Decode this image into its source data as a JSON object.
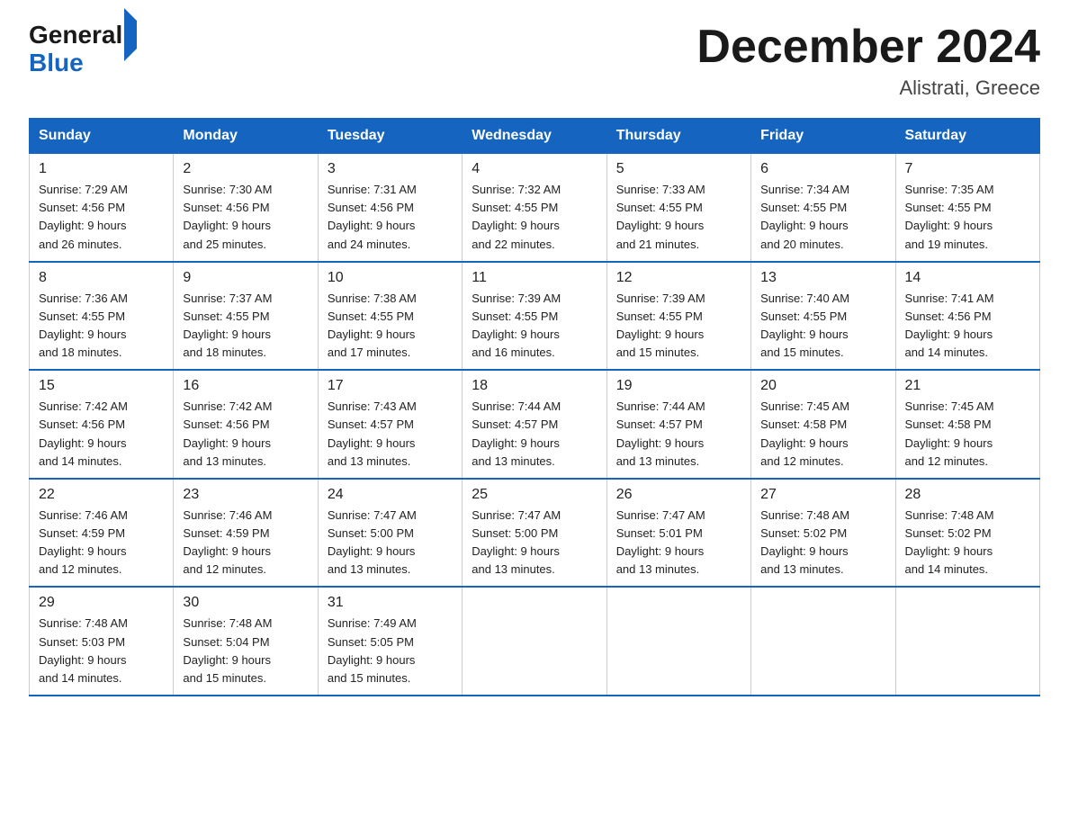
{
  "logo": {
    "general": "General",
    "blue": "Blue"
  },
  "title": "December 2024",
  "location": "Alistrati, Greece",
  "weekdays": [
    "Sunday",
    "Monday",
    "Tuesday",
    "Wednesday",
    "Thursday",
    "Friday",
    "Saturday"
  ],
  "weeks": [
    [
      {
        "day": "1",
        "sunrise": "7:29 AM",
        "sunset": "4:56 PM",
        "daylight": "9 hours and 26 minutes."
      },
      {
        "day": "2",
        "sunrise": "7:30 AM",
        "sunset": "4:56 PM",
        "daylight": "9 hours and 25 minutes."
      },
      {
        "day": "3",
        "sunrise": "7:31 AM",
        "sunset": "4:56 PM",
        "daylight": "9 hours and 24 minutes."
      },
      {
        "day": "4",
        "sunrise": "7:32 AM",
        "sunset": "4:55 PM",
        "daylight": "9 hours and 22 minutes."
      },
      {
        "day": "5",
        "sunrise": "7:33 AM",
        "sunset": "4:55 PM",
        "daylight": "9 hours and 21 minutes."
      },
      {
        "day": "6",
        "sunrise": "7:34 AM",
        "sunset": "4:55 PM",
        "daylight": "9 hours and 20 minutes."
      },
      {
        "day": "7",
        "sunrise": "7:35 AM",
        "sunset": "4:55 PM",
        "daylight": "9 hours and 19 minutes."
      }
    ],
    [
      {
        "day": "8",
        "sunrise": "7:36 AM",
        "sunset": "4:55 PM",
        "daylight": "9 hours and 18 minutes."
      },
      {
        "day": "9",
        "sunrise": "7:37 AM",
        "sunset": "4:55 PM",
        "daylight": "9 hours and 18 minutes."
      },
      {
        "day": "10",
        "sunrise": "7:38 AM",
        "sunset": "4:55 PM",
        "daylight": "9 hours and 17 minutes."
      },
      {
        "day": "11",
        "sunrise": "7:39 AM",
        "sunset": "4:55 PM",
        "daylight": "9 hours and 16 minutes."
      },
      {
        "day": "12",
        "sunrise": "7:39 AM",
        "sunset": "4:55 PM",
        "daylight": "9 hours and 15 minutes."
      },
      {
        "day": "13",
        "sunrise": "7:40 AM",
        "sunset": "4:55 PM",
        "daylight": "9 hours and 15 minutes."
      },
      {
        "day": "14",
        "sunrise": "7:41 AM",
        "sunset": "4:56 PM",
        "daylight": "9 hours and 14 minutes."
      }
    ],
    [
      {
        "day": "15",
        "sunrise": "7:42 AM",
        "sunset": "4:56 PM",
        "daylight": "9 hours and 14 minutes."
      },
      {
        "day": "16",
        "sunrise": "7:42 AM",
        "sunset": "4:56 PM",
        "daylight": "9 hours and 13 minutes."
      },
      {
        "day": "17",
        "sunrise": "7:43 AM",
        "sunset": "4:57 PM",
        "daylight": "9 hours and 13 minutes."
      },
      {
        "day": "18",
        "sunrise": "7:44 AM",
        "sunset": "4:57 PM",
        "daylight": "9 hours and 13 minutes."
      },
      {
        "day": "19",
        "sunrise": "7:44 AM",
        "sunset": "4:57 PM",
        "daylight": "9 hours and 13 minutes."
      },
      {
        "day": "20",
        "sunrise": "7:45 AM",
        "sunset": "4:58 PM",
        "daylight": "9 hours and 12 minutes."
      },
      {
        "day": "21",
        "sunrise": "7:45 AM",
        "sunset": "4:58 PM",
        "daylight": "9 hours and 12 minutes."
      }
    ],
    [
      {
        "day": "22",
        "sunrise": "7:46 AM",
        "sunset": "4:59 PM",
        "daylight": "9 hours and 12 minutes."
      },
      {
        "day": "23",
        "sunrise": "7:46 AM",
        "sunset": "4:59 PM",
        "daylight": "9 hours and 12 minutes."
      },
      {
        "day": "24",
        "sunrise": "7:47 AM",
        "sunset": "5:00 PM",
        "daylight": "9 hours and 13 minutes."
      },
      {
        "day": "25",
        "sunrise": "7:47 AM",
        "sunset": "5:00 PM",
        "daylight": "9 hours and 13 minutes."
      },
      {
        "day": "26",
        "sunrise": "7:47 AM",
        "sunset": "5:01 PM",
        "daylight": "9 hours and 13 minutes."
      },
      {
        "day": "27",
        "sunrise": "7:48 AM",
        "sunset": "5:02 PM",
        "daylight": "9 hours and 13 minutes."
      },
      {
        "day": "28",
        "sunrise": "7:48 AM",
        "sunset": "5:02 PM",
        "daylight": "9 hours and 14 minutes."
      }
    ],
    [
      {
        "day": "29",
        "sunrise": "7:48 AM",
        "sunset": "5:03 PM",
        "daylight": "9 hours and 14 minutes."
      },
      {
        "day": "30",
        "sunrise": "7:48 AM",
        "sunset": "5:04 PM",
        "daylight": "9 hours and 15 minutes."
      },
      {
        "day": "31",
        "sunrise": "7:49 AM",
        "sunset": "5:05 PM",
        "daylight": "9 hours and 15 minutes."
      },
      null,
      null,
      null,
      null
    ]
  ]
}
